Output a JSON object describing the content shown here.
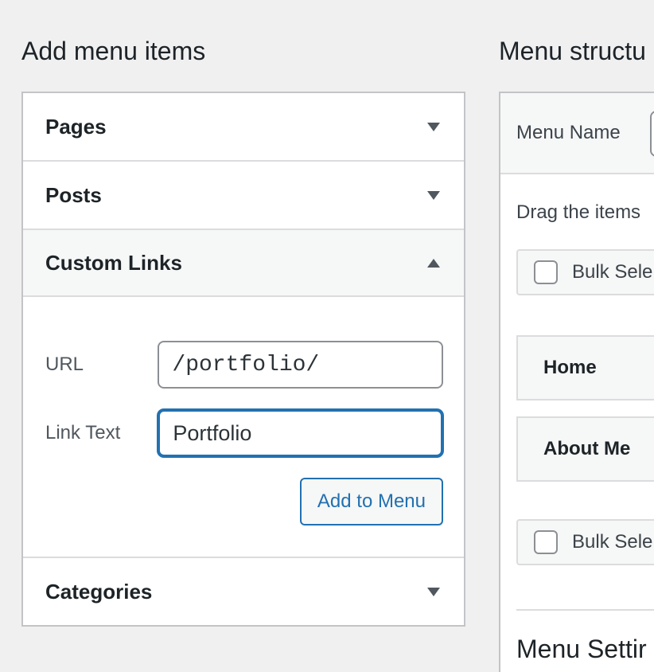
{
  "left": {
    "title": "Add menu items",
    "sections": {
      "pages": "Pages",
      "posts": "Posts",
      "custom_links": "Custom Links",
      "categories": "Categories"
    },
    "custom_links": {
      "url_label": "URL",
      "url_value": "/portfolio/",
      "link_text_label": "Link Text",
      "link_text_value": "Portfolio",
      "add_button": "Add to Menu"
    }
  },
  "right": {
    "title": "Menu structu",
    "menu_name_label": "Menu Name",
    "drag_text": "Drag the items",
    "bulk_select": "Bulk Sele",
    "items": [
      "Home",
      "About Me"
    ],
    "settings_title": "Menu Settir"
  },
  "icons": {
    "collapsed": "chevron-down-icon",
    "expanded": "chevron-up-icon"
  },
  "colors": {
    "accent": "#2271b1",
    "background": "#f0f0f1",
    "panel": "#ffffff",
    "text": "#1d2327"
  }
}
